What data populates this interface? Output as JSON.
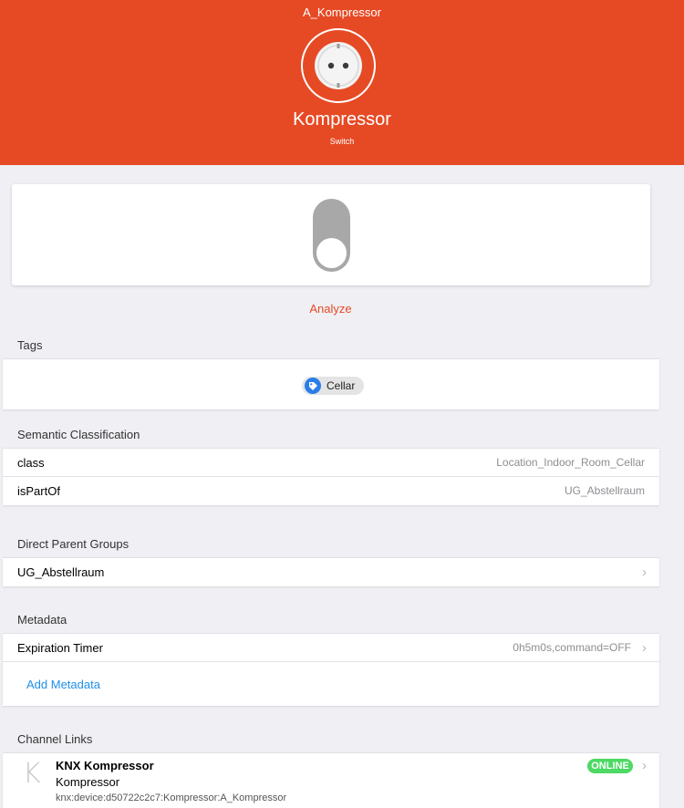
{
  "header": {
    "item_name": "A_Kompressor",
    "label": "Kompressor",
    "category": "Switch",
    "icon": "power-outlet-icon",
    "background_color": "#e64a24"
  },
  "toggle": {
    "state": "OFF"
  },
  "analyze_label": "Analyze",
  "tags": {
    "title": "Tags",
    "items": [
      {
        "label": "Cellar",
        "icon": "tag-icon"
      }
    ]
  },
  "semantic": {
    "title": "Semantic Classification",
    "rows": [
      {
        "key": "class",
        "value": "Location_Indoor_Room_Cellar"
      },
      {
        "key": "isPartOf",
        "value": "UG_Abstellraum"
      }
    ]
  },
  "parent_groups": {
    "title": "Direct Parent Groups",
    "items": [
      {
        "label": "UG_Abstellraum"
      }
    ]
  },
  "metadata": {
    "title": "Metadata",
    "rows": [
      {
        "key": "Expiration Timer",
        "value": "0h5m0s,command=OFF"
      }
    ],
    "add_label": "Add Metadata"
  },
  "channel_links": {
    "title": "Channel Links",
    "items": [
      {
        "avatar_letter": "K",
        "title": "KNX Kompressor",
        "subtitle": "Kompressor",
        "channel_uid": "knx:device:d50722c2c7:Kompressor:A_Kompressor",
        "status": "ONLINE",
        "status_color": "#4cd964"
      }
    ]
  }
}
